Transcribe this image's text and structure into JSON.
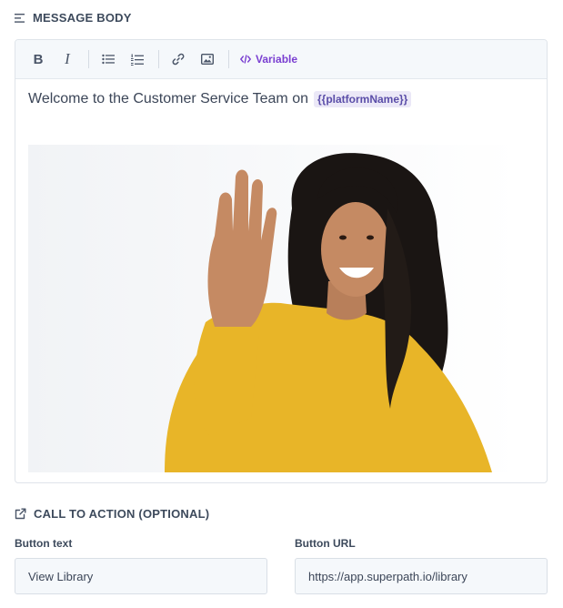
{
  "message_body": {
    "heading": "MESSAGE BODY",
    "heading_icon": "text-align-left-icon"
  },
  "toolbar": {
    "bold_label": "B",
    "italic_label": "I",
    "icons": [
      "bold-icon",
      "italic-icon",
      "bullet-list-icon",
      "numbered-list-icon",
      "link-icon",
      "image-icon",
      "code-icon"
    ],
    "variable_label": "Variable",
    "variable_color": "#7a3fd1"
  },
  "editor": {
    "text": "Welcome to the Customer Service Team on",
    "variable_chip": "{{platformName}}",
    "image": "woman-waving-photo"
  },
  "cta": {
    "heading": "CALL TO ACTION (OPTIONAL)",
    "heading_icon": "external-link-icon",
    "button_text_label": "Button text",
    "button_text_value": "View Library",
    "button_url_label": "Button URL",
    "button_url_value": "https://app.superpath.io/library"
  }
}
